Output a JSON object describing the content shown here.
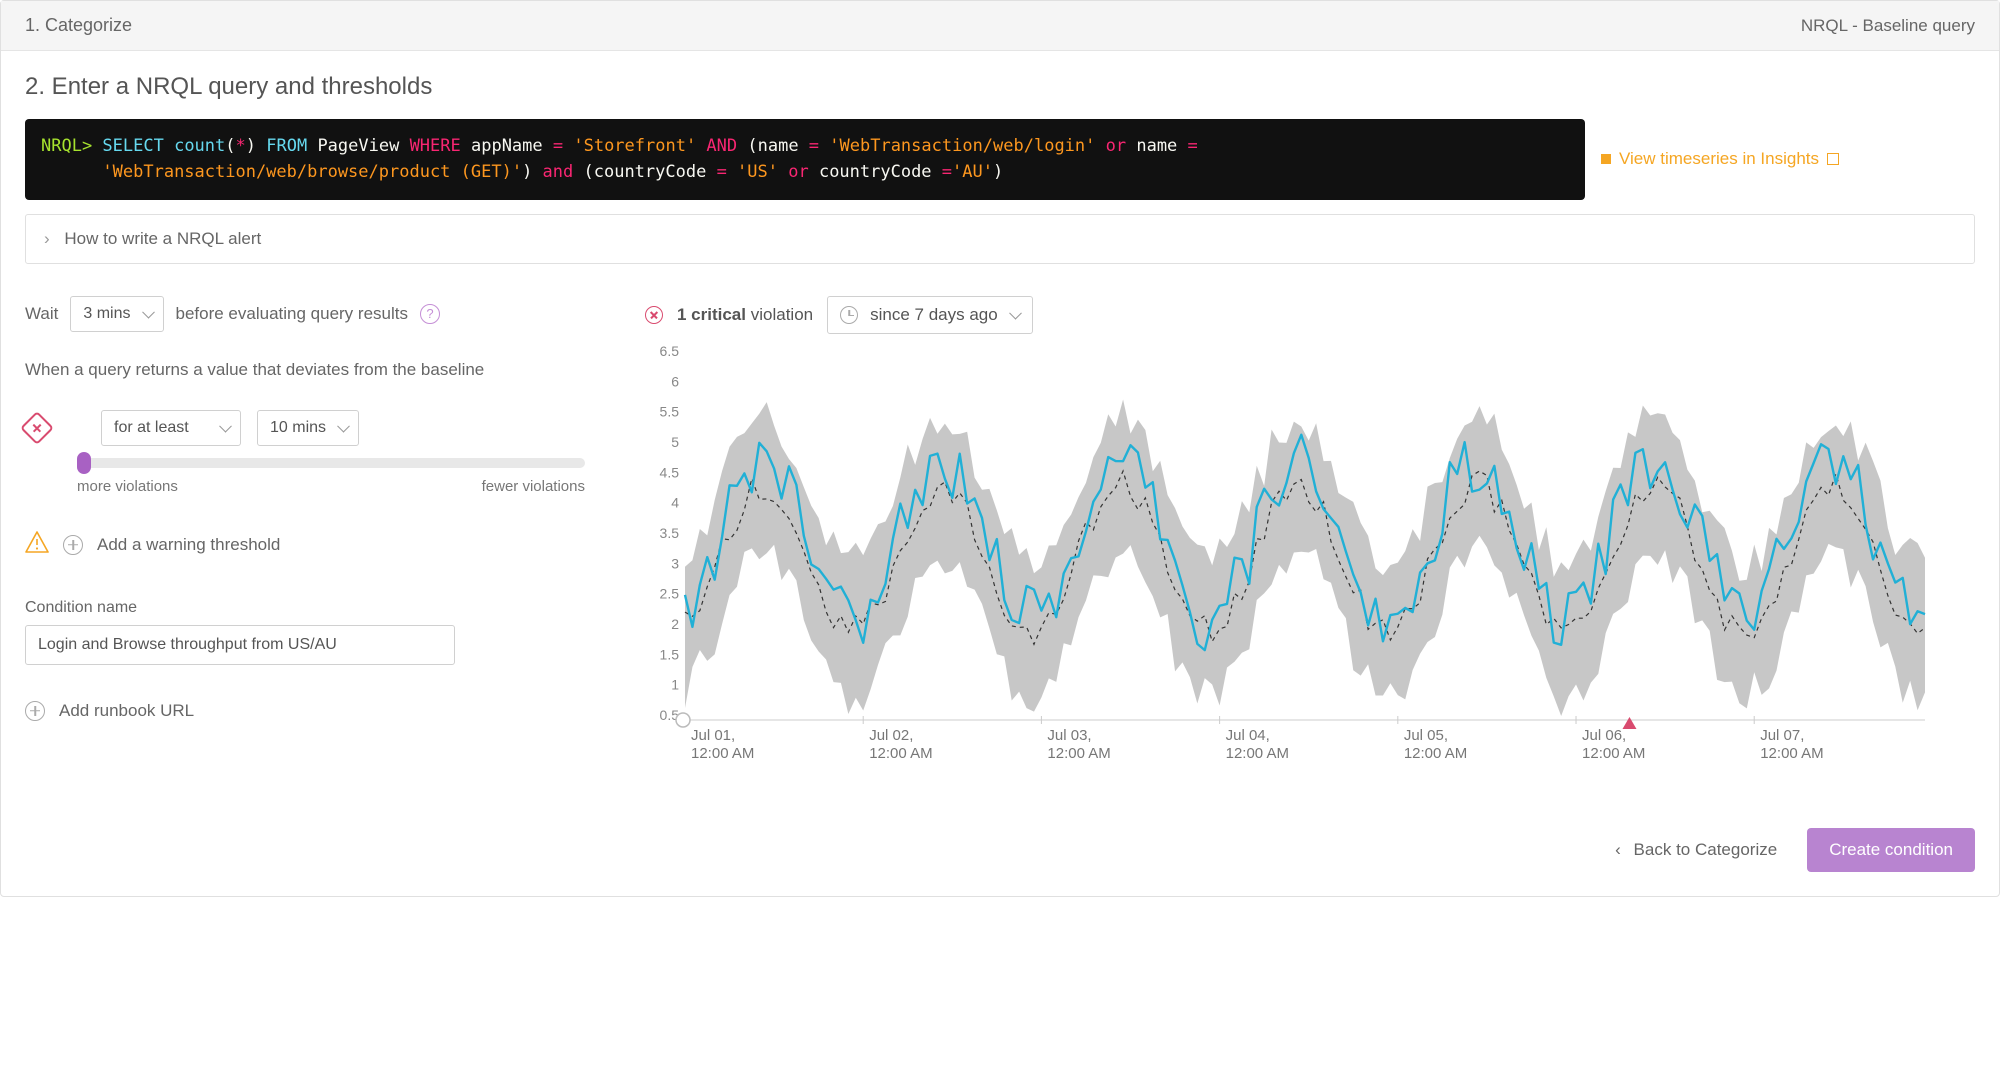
{
  "header": {
    "step1_label": "1. Categorize",
    "right_label": "NRQL - Baseline query"
  },
  "section_title": "2. Enter a NRQL query and thresholds",
  "query": {
    "prompt": "NRQL>",
    "tokens": [
      {
        "t": "SELECT",
        "c": "blue"
      },
      {
        "t": " count",
        "c": "blue"
      },
      {
        "t": "(",
        "c": "white"
      },
      {
        "t": "*",
        "c": "pink"
      },
      {
        "t": ") ",
        "c": "white"
      },
      {
        "t": "FROM",
        "c": "blue"
      },
      {
        "t": " PageView ",
        "c": "white"
      },
      {
        "t": "WHERE",
        "c": "pink"
      },
      {
        "t": " appName ",
        "c": "white"
      },
      {
        "t": "=",
        "c": "pink"
      },
      {
        "t": " 'Storefront' ",
        "c": "orange"
      },
      {
        "t": "AND",
        "c": "pink"
      },
      {
        "t": " (name ",
        "c": "white"
      },
      {
        "t": "=",
        "c": "pink"
      },
      {
        "t": " 'WebTransaction/web/login' ",
        "c": "orange"
      },
      {
        "t": "or",
        "c": "pink"
      },
      {
        "t": " name ",
        "c": "white"
      },
      {
        "t": "=",
        "c": "pink"
      },
      {
        "t": "\n      'WebTransaction/web/browse/product (GET)'",
        "c": "orange"
      },
      {
        "t": ") ",
        "c": "white"
      },
      {
        "t": "and",
        "c": "pink"
      },
      {
        "t": " (countryCode ",
        "c": "white"
      },
      {
        "t": "=",
        "c": "pink"
      },
      {
        "t": " 'US' ",
        "c": "orange"
      },
      {
        "t": "or",
        "c": "pink"
      },
      {
        "t": " countryCode ",
        "c": "white"
      },
      {
        "t": "=",
        "c": "pink"
      },
      {
        "t": "'AU'",
        "c": "orange"
      },
      {
        "t": ")",
        "c": "white"
      }
    ]
  },
  "insights_link": "View timeseries in Insights",
  "howto_label": "How to write a NRQL alert",
  "wait": {
    "prefix": "Wait",
    "value": "3 mins",
    "suffix": "before evaluating query results"
  },
  "deviation_text": "When a query returns a value that deviates from the baseline",
  "critical_threshold": {
    "operator": "for at least",
    "duration": "10 mins",
    "slider_left_label": "more violations",
    "slider_right_label": "fewer violations"
  },
  "add_warning_label": "Add a warning threshold",
  "condition_name_label": "Condition name",
  "condition_name_value": "Login and Browse throughput from US/AU",
  "add_runbook_label": "Add runbook URL",
  "violations": {
    "count_text": "1 critical",
    "suffix": "violation",
    "since": "since 7 days ago"
  },
  "footer": {
    "back": "Back to Categorize",
    "primary": "Create condition"
  },
  "chart_data": {
    "type": "line",
    "ylim": [
      0.5,
      6.5
    ],
    "y_ticks": [
      0.5,
      1,
      1.5,
      2,
      2.5,
      3,
      3.5,
      4,
      4.5,
      5,
      5.5,
      6,
      6.5
    ],
    "x_labels": [
      "Jul 01,\n12:00 AM",
      "Jul 02,\n12:00 AM",
      "Jul 03,\n12:00 AM",
      "Jul 04,\n12:00 AM",
      "Jul 05,\n12:00 AM",
      "Jul 06,\n12:00 AM",
      "Jul 07,\n12:00 AM"
    ],
    "x_per_day_points": 24,
    "days": 7,
    "series": [
      {
        "name": "baseline_upper",
        "role": "band-upper",
        "amplitude": 1.2,
        "offset": 4.2,
        "noise": 0.35
      },
      {
        "name": "baseline_lower",
        "role": "band-lower",
        "amplitude": 1.2,
        "offset": 2.0,
        "noise": 0.35
      },
      {
        "name": "baseline_mid",
        "role": "dashed",
        "amplitude": 1.2,
        "offset": 3.1,
        "noise": 0.25
      },
      {
        "name": "actual",
        "role": "line",
        "color": "#21b0d6",
        "amplitude": 1.3,
        "offset": 3.4,
        "noise": 0.55
      }
    ],
    "violation_marker_day": 5.3
  }
}
